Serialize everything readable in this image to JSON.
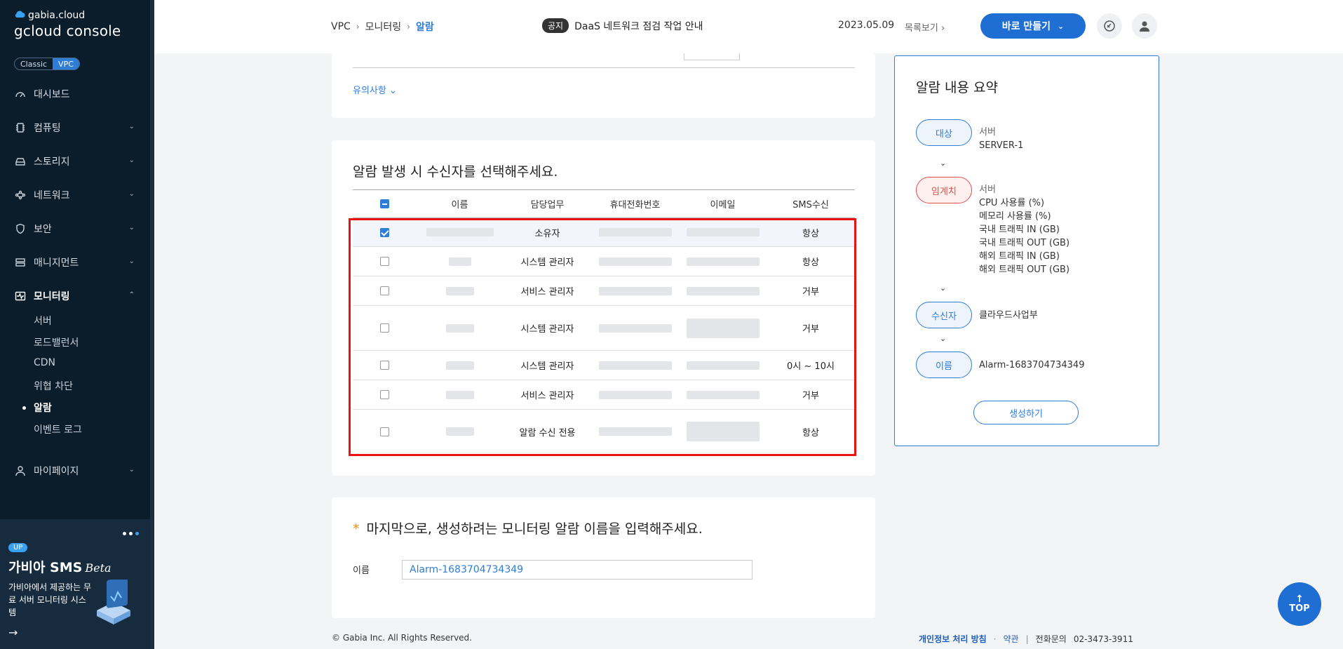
{
  "sidebar": {
    "brand": "gabia.cloud",
    "console": "gcloud console",
    "env": [
      "Classic",
      "VPC"
    ],
    "env_selected": "VPC",
    "nav": [
      {
        "label": "대시보드",
        "icon": "dashboard-icon"
      },
      {
        "label": "컴퓨팅",
        "icon": "chip-icon"
      },
      {
        "label": "스토리지",
        "icon": "storage-icon"
      },
      {
        "label": "네트워크",
        "icon": "network-icon"
      },
      {
        "label": "보안",
        "icon": "shield-icon"
      },
      {
        "label": "매니지먼트",
        "icon": "management-icon"
      },
      {
        "label": "모니터링",
        "icon": "monitoring-icon"
      },
      {
        "label": "마이페이지",
        "icon": "user-icon"
      }
    ],
    "monitoring_sub": [
      "서버",
      "로드밸런서",
      "CDN",
      "위협 차단",
      "알람",
      "이벤트 로그"
    ],
    "monitoring_sub_active": "알람",
    "promo": {
      "badge": "UP",
      "title": "가비아 SMS",
      "beta": "Beta",
      "desc": "가비아에서 제공하는 무료 서버 모니터링 시스템"
    }
  },
  "header": {
    "breadcrumb": [
      "VPC",
      "모니터링",
      "알람"
    ],
    "notice_tag": "공지",
    "notice_text": "DaaS 네트워크 점검 작업 안내",
    "notice_date": "2023.05.09",
    "notice_list": "목록보기",
    "create_label": "바로 만들기"
  },
  "notes_link": "유의사항",
  "recipients": {
    "title": "알람 발생 시 수신자를 선택해주세요.",
    "columns": [
      "이름",
      "담당업무",
      "휴대전화번호",
      "이메일",
      "SMS수신"
    ],
    "rows": [
      {
        "role": "소유자",
        "sms": "항상",
        "checked": true
      },
      {
        "role": "시스템 관리자",
        "sms": "항상",
        "checked": false
      },
      {
        "role": "서비스 관리자",
        "sms": "거부",
        "checked": false
      },
      {
        "role": "시스템 관리자",
        "sms": "거부",
        "checked": false
      },
      {
        "role": "시스템 관리자",
        "sms": "0시 ~ 10시",
        "checked": false
      },
      {
        "role": "서비스 관리자",
        "sms": "거부",
        "checked": false
      },
      {
        "role": "알람 수신 전용",
        "sms": "항상",
        "checked": false
      }
    ]
  },
  "alarm_name": {
    "question": "마지막으로, 생성하려는 모니터링 알람 이름을 입력해주세요.",
    "label": "이름",
    "value": "Alarm-1683704734349"
  },
  "summary": {
    "title": "알람 내용 요약",
    "target_label": "대상",
    "target_type": "서버",
    "target_value": "SERVER-1",
    "threshold_label": "임계치",
    "threshold_type": "서버",
    "thresholds": [
      "CPU 사용률 (%)",
      "메모리 사용률 (%)",
      "국내 트래픽 IN (GB)",
      "국내 트래픽 OUT (GB)",
      "해외 트래픽 IN (GB)",
      "해외 트래픽 OUT (GB)"
    ],
    "recipient_label": "수신자",
    "recipient_value": "클라우드사업부",
    "name_label": "이름",
    "name_value": "Alarm-1683704734349",
    "create_label": "생성하기"
  },
  "footer": {
    "copyright": "© Gabia Inc. All Rights Reserved.",
    "privacy": "개인정보 처리 방침",
    "terms": "약관",
    "contact_label": "전화문의",
    "contact_number": "02-3473-3911"
  },
  "top_label": "TOP"
}
